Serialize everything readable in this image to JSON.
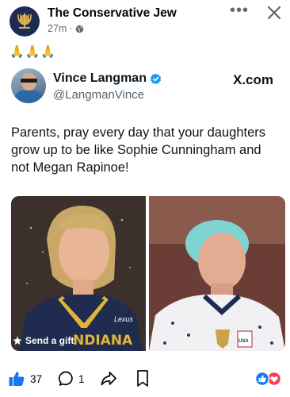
{
  "post": {
    "author": "The Conservative Jew",
    "time": "27m",
    "separator": "·",
    "emoji_line": "🙏🙏🙏",
    "more": "•••"
  },
  "embedded": {
    "name": "Vince Langman",
    "handle": "@LangmanVince",
    "brand": "X.com",
    "text": "Parents, pray every day that your daughters grow up to be like Sophie Cunningham and not Megan Rapinoe!",
    "send_gift": "Send a gift",
    "jersey_text": "NDIANA",
    "left_name": "Lexus",
    "right_flag": "USA"
  },
  "footer": {
    "likes": "37",
    "comments": "1"
  },
  "colors": {
    "fb_blue": "#1877f2",
    "x_verified": "#1d9bf0",
    "love_red": "#f33e58",
    "meta_gray": "#65676b"
  }
}
